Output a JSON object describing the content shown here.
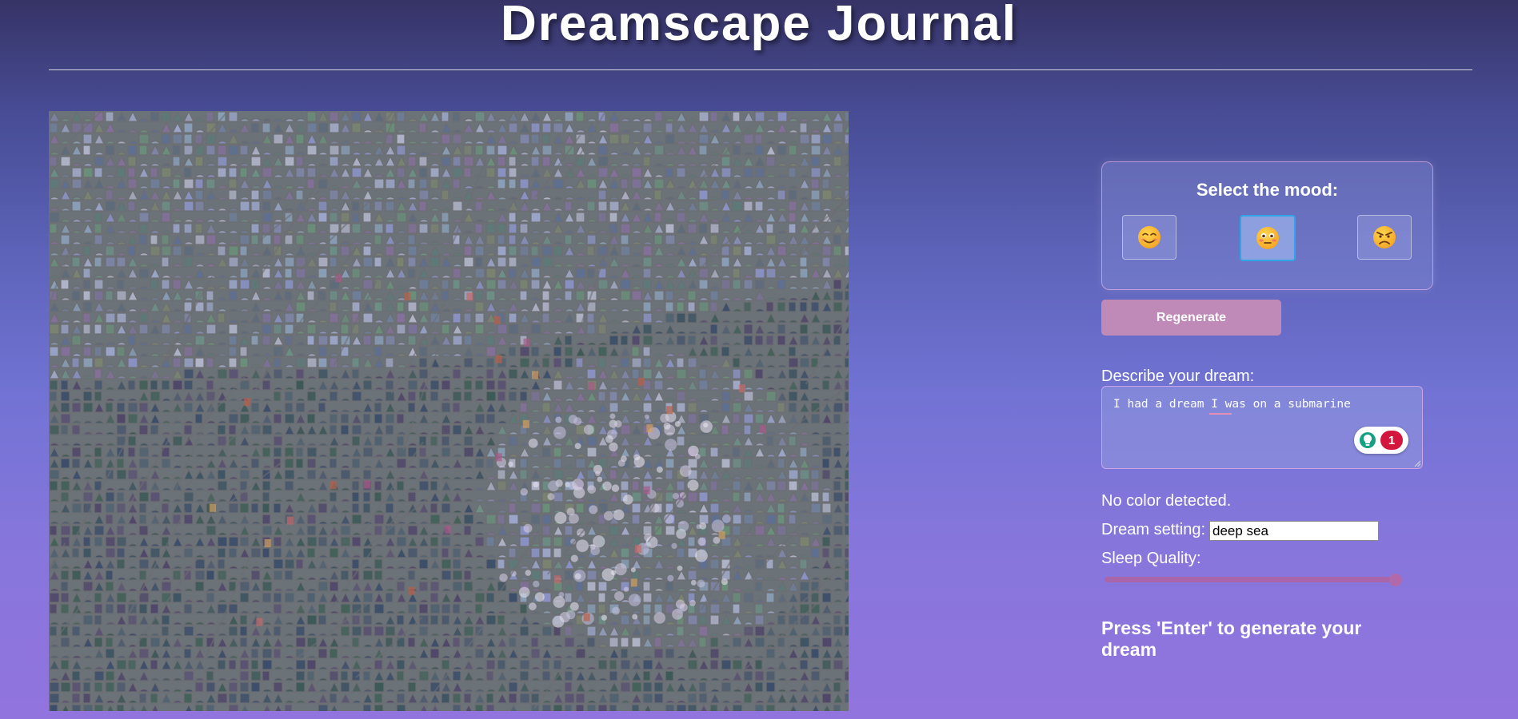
{
  "header": {
    "title": "Dreamscape Journal"
  },
  "canvas": {
    "description_icon": "mosaic-dream-image"
  },
  "mood": {
    "title": "Select the mood:",
    "options": [
      {
        "name": "happy",
        "icon": "smiling-face-icon",
        "selected": false
      },
      {
        "name": "neutral",
        "icon": "flushed-face-icon",
        "selected": true
      },
      {
        "name": "angry",
        "icon": "angry-face-icon",
        "selected": false
      }
    ]
  },
  "actions": {
    "regenerate_label": "Regenerate"
  },
  "dream": {
    "label": "Describe your dream:",
    "value": "I had a dream I was on a submarine",
    "grammar_issue_count": "1"
  },
  "color_status": "No color detected.",
  "setting": {
    "label": "Dream setting:",
    "value": "deep sea"
  },
  "sleep_quality": {
    "label": "Sleep Quality:",
    "value_fraction": 1.0
  },
  "instructions": "Press 'Enter' to generate your dream",
  "colors": {
    "accent_button": "#c08ab8",
    "selected_border": "#2fa5e6",
    "slider": "#a866a8",
    "badge_red": "#d2163d"
  }
}
